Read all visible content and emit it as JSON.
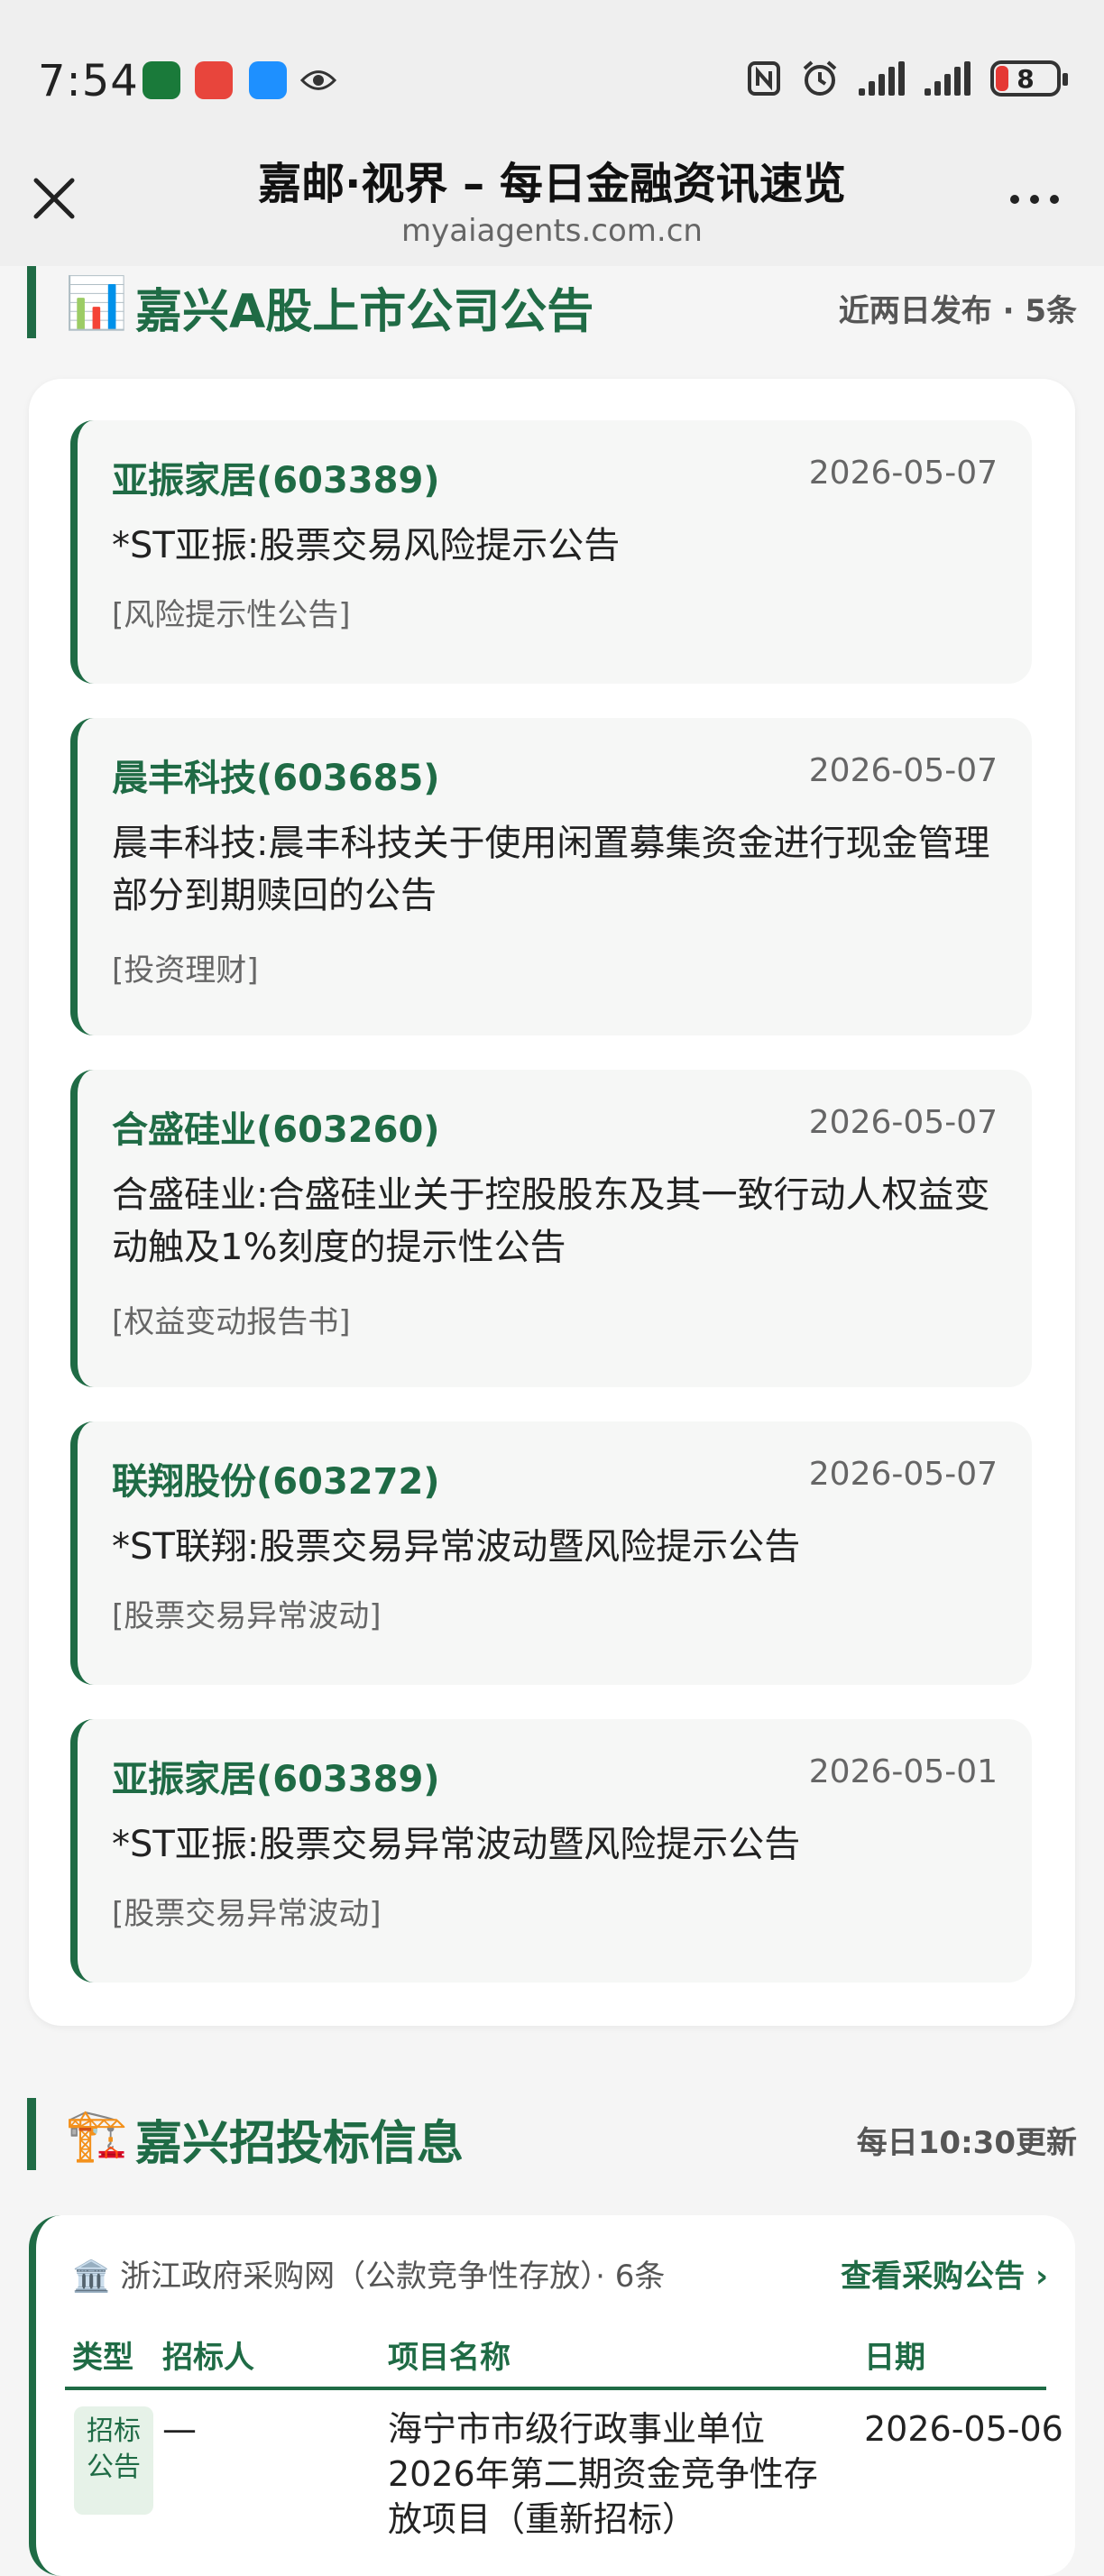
{
  "status": {
    "time": "7:54",
    "battery": "8"
  },
  "header": {
    "title": "嘉邮·视界 – 每日金融资讯速览",
    "url": "myaiagents.com.cn"
  },
  "announcements": {
    "emoji": "📊",
    "title": "嘉兴A股上市公司公告",
    "meta": "近两日发布 · 5条",
    "items": [
      {
        "company": "亚振家居(603389)",
        "date": "2026-05-07",
        "title": "*ST亚振:股票交易风险提示公告",
        "tag": "[风险提示性公告]"
      },
      {
        "company": "晨丰科技(603685)",
        "date": "2026-05-07",
        "title": "晨丰科技:晨丰科技关于使用闲置募集资金进行现金管理部分到期赎回的公告",
        "tag": "[投资理财]"
      },
      {
        "company": "合盛硅业(603260)",
        "date": "2026-05-07",
        "title": "合盛硅业:合盛硅业关于控股股东及其一致行动人权益变动触及1%刻度的提示性公告",
        "tag": "[权益变动报告书]"
      },
      {
        "company": "联翔股份(603272)",
        "date": "2026-05-07",
        "title": "*ST联翔:股票交易异常波动暨风险提示公告",
        "tag": "[股票交易异常波动]"
      },
      {
        "company": "亚振家居(603389)",
        "date": "2026-05-01",
        "title": "*ST亚振:股票交易异常波动暨风险提示公告",
        "tag": "[股票交易异常波动]"
      }
    ]
  },
  "bidding": {
    "emoji": "🏗️",
    "title": "嘉兴招投标信息",
    "meta": "每日10:30更新",
    "source_icon": "🏛️",
    "source": "浙江政府采购网（公款竞争性存放）· 6条",
    "link": "查看采购公告 ›",
    "columns": [
      "类型",
      "招标人",
      "项目名称",
      "日期"
    ],
    "rows": [
      {
        "type": "招标公告",
        "bidder": "—",
        "project": "海宁市市级行政事业单位2026年第二期资金竞争性存放项目（重新招标）",
        "date": "2026-05-06"
      }
    ]
  }
}
